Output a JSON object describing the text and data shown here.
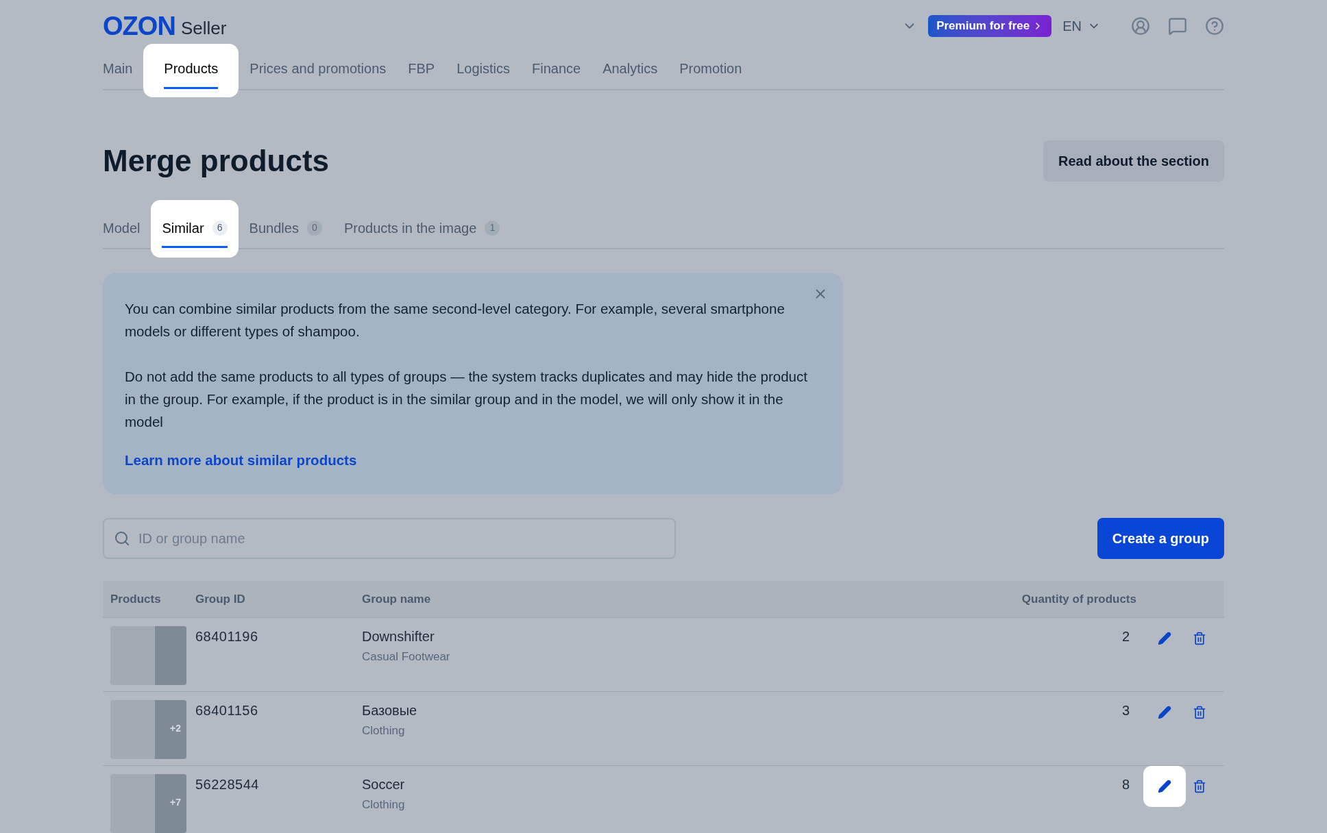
{
  "header": {
    "logo": "OZON",
    "logo_suffix": "Seller",
    "premium": "Premium for free",
    "language": "EN"
  },
  "nav": [
    {
      "label": "Main",
      "selected": false,
      "highlighted": false
    },
    {
      "label": "Products",
      "selected": true,
      "highlighted": true
    },
    {
      "label": "Prices and promotions",
      "selected": false,
      "highlighted": false
    },
    {
      "label": "FBP",
      "selected": false,
      "highlighted": false
    },
    {
      "label": "Logistics",
      "selected": false,
      "highlighted": false
    },
    {
      "label": "Finance",
      "selected": false,
      "highlighted": false
    },
    {
      "label": "Analytics",
      "selected": false,
      "highlighted": false
    },
    {
      "label": "Promotion",
      "selected": false,
      "highlighted": false
    }
  ],
  "page": {
    "title": "Merge products",
    "read_button": "Read about the section"
  },
  "tabs": [
    {
      "label": "Model",
      "selected": false,
      "highlighted": false
    },
    {
      "label": "Similar",
      "count": "6",
      "selected": true,
      "highlighted": true
    },
    {
      "label": "Bundles",
      "count": "0",
      "selected": false,
      "highlighted": false
    },
    {
      "label": "Products in the image",
      "count": "1",
      "selected": false,
      "highlighted": false
    }
  ],
  "info": {
    "paragraphs": [
      "You can combine similar products from the same second-level category. For example, several smartphone models or different types of shampoo.",
      "Do not add the same products to all types of groups — the system tracks duplicates and may hide the product in the group. For example, if the product is in the similar group and in the model, we will only show it in the model"
    ],
    "link": "Learn more about similar products"
  },
  "search": {
    "placeholder": "ID or group name"
  },
  "create_button": "Create a group",
  "table": {
    "columns": [
      "Products",
      "Group ID",
      "Group name",
      "Quantity of products"
    ],
    "rows": [
      {
        "group_id": "68401196",
        "name": "Downshifter",
        "category": "Casual Footwear",
        "quantity": "2",
        "edit_highlighted": false
      },
      {
        "extra": "+2",
        "group_id": "68401156",
        "name": "Базовые",
        "category": "Clothing",
        "quantity": "3",
        "edit_highlighted": false
      },
      {
        "extra": "+7",
        "group_id": "56228544",
        "name": "Soccer",
        "category": "Clothing",
        "quantity": "8",
        "edit_highlighted": true
      }
    ]
  }
}
